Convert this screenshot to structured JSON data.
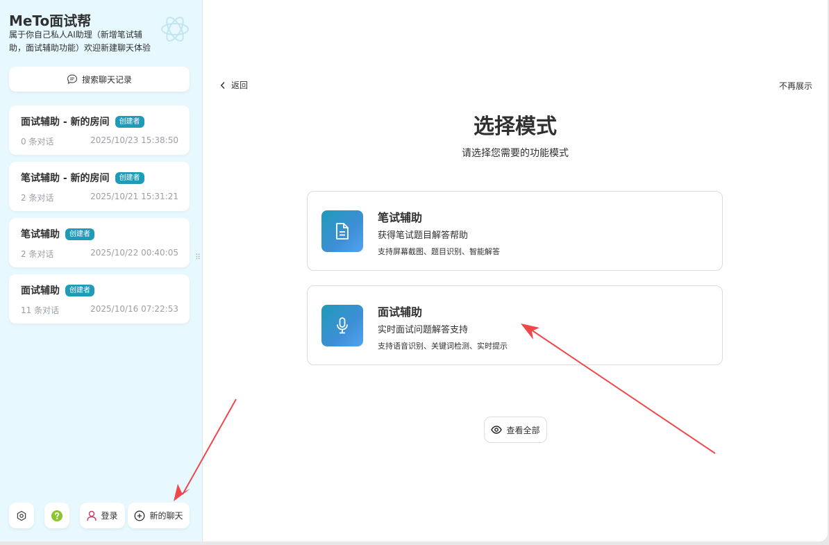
{
  "sidebar": {
    "title": "MeTo面试帮",
    "subtitle": "属于你自己私人AI助理（新增笔试辅助，面试辅助功能）欢迎新建聊天体验",
    "search_label": "搜索聊天记录",
    "chats": [
      {
        "title": "面试辅助 - 新的房间",
        "badge": "创建者",
        "count": "0 条对话",
        "time": "2025/10/23 15:38:50"
      },
      {
        "title": "笔试辅助 - 新的房间",
        "badge": "创建者",
        "count": "2 条对话",
        "time": "2025/10/21 15:31:21"
      },
      {
        "title": "笔试辅助",
        "badge": "创建者",
        "count": "2 条对话",
        "time": "2025/10/22 00:40:05"
      },
      {
        "title": "面试辅助",
        "badge": "创建者",
        "count": "11 条对话",
        "time": "2025/10/16 07:22:53"
      }
    ],
    "login_label": "登录",
    "new_chat_label": "新的聊天"
  },
  "main": {
    "back_label": "返回",
    "no_show_label": "不再展示",
    "title": "选择模式",
    "subtitle": "请选择您需要的功能模式",
    "modes": [
      {
        "title": "笔试辅助",
        "desc": "获得笔试题目解答帮助",
        "features": "支持屏幕截图、题目识别、智能解答",
        "icon": "document-icon"
      },
      {
        "title": "面试辅助",
        "desc": "实时面试问题解答支持",
        "features": "支持语音识别、关键词检测、实时提示",
        "icon": "microphone-icon"
      }
    ],
    "view_all_label": "查看全部"
  },
  "colors": {
    "sidebar_bg": "#e7f8fe",
    "accent": "#1f9ab7",
    "annotation_arrow": "#f0474a",
    "help_icon": "#8bc52c"
  }
}
